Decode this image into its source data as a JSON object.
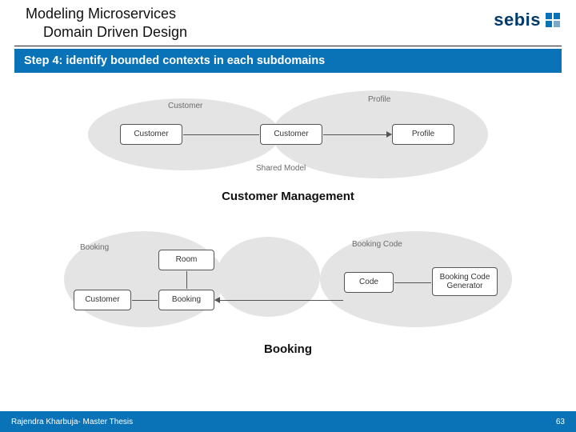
{
  "header": {
    "title_line1": "Modeling Microservices",
    "title_line2": "Domain Driven Design",
    "logo_text": "sebis"
  },
  "banner": "Step 4: identify bounded contexts in each subdomains",
  "diagram1": {
    "context_labels": {
      "left": "Customer",
      "right": "Profile",
      "shared": "Shared Model"
    },
    "boxes": {
      "b1": "Customer",
      "b2": "Customer",
      "b3": "Profile"
    },
    "caption": "Customer Management"
  },
  "diagram2": {
    "context_labels": {
      "left": "Booking",
      "mid": "",
      "right": "Booking Code"
    },
    "boxes": {
      "room": "Room",
      "customer": "Customer",
      "booking": "Booking",
      "code": "Code",
      "generator": "Booking Code Generator"
    },
    "caption": "Booking"
  },
  "footer": {
    "left": "Rajendra Kharbuja- Master Thesis",
    "right": "63"
  }
}
